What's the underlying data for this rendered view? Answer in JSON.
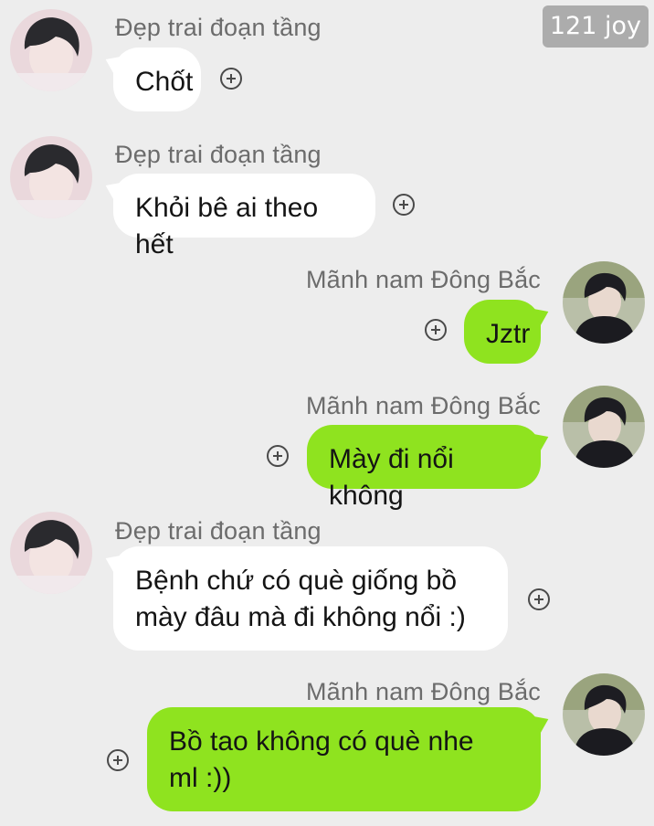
{
  "watermark": "121 joy",
  "messages": [
    {
      "sender": "Đẹp trai đoạn tầng",
      "text": "Chốt",
      "side": "in"
    },
    {
      "sender": "Đẹp trai đoạn tầng",
      "text": "Khỏi bê ai theo hết",
      "side": "in"
    },
    {
      "sender": "Mãnh nam Đông Bắc",
      "text": "Jztr",
      "side": "out"
    },
    {
      "sender": "Mãnh nam Đông Bắc",
      "text": "Mày đi nổi không",
      "side": "out"
    },
    {
      "sender": "Đẹp trai đoạn tầng",
      "text": "Bệnh chứ có què giống bồ\nmày đâu mà đi không nổi :)",
      "side": "in"
    },
    {
      "sender": "Mãnh nam Đông Bắc",
      "text": "Bồ tao không có què nhe\nml :))",
      "side": "out"
    }
  ],
  "colors": {
    "background": "#ededed",
    "outgoing_bubble": "#8fe31f",
    "incoming_bubble": "#ffffff"
  },
  "icons": {
    "reaction": "add-reaction-icon"
  }
}
